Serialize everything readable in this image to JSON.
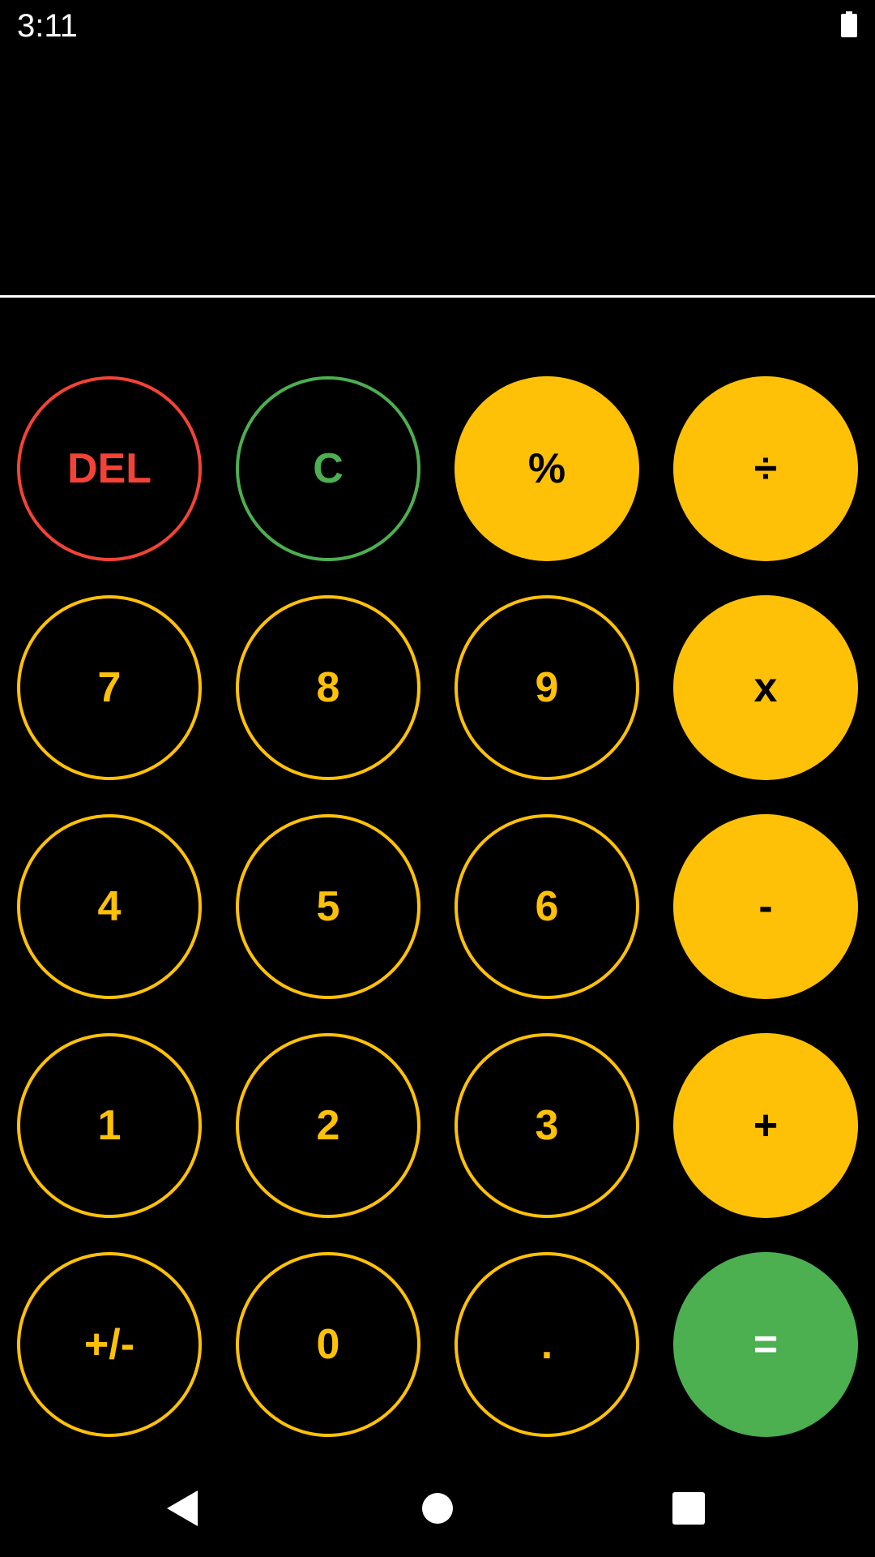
{
  "status_bar": {
    "time": "3:11",
    "battery_icon": "battery-full-icon"
  },
  "display": {
    "value": ""
  },
  "colors": {
    "background": "#000000",
    "accent": "#FFC107",
    "delete": "#F44336",
    "clear": "#4CAF50",
    "equals": "#4CAF50",
    "divider": "#FFFFFF"
  },
  "keys": {
    "del": "DEL",
    "clear": "C",
    "percent": "%",
    "divide": "÷",
    "seven": "7",
    "eight": "8",
    "nine": "9",
    "multiply": "x",
    "four": "4",
    "five": "5",
    "six": "6",
    "minus": "-",
    "one": "1",
    "two": "2",
    "three": "3",
    "plus": "+",
    "plus_minus": "+/-",
    "zero": "0",
    "decimal": ".",
    "equals": "="
  },
  "nav_bar": {
    "back_icon": "back-triangle-icon",
    "home_icon": "home-circle-icon",
    "recent_icon": "recent-apps-square-icon"
  }
}
